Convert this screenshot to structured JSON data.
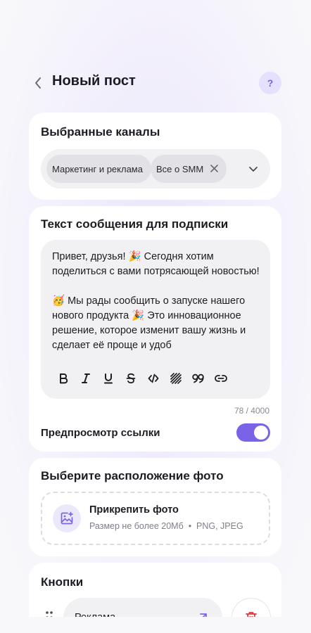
{
  "header": {
    "title": "Новый пост",
    "help_label": "?"
  },
  "channels": {
    "title": "Выбранные каналы",
    "chips": [
      {
        "label": "Маркетинг и реклама"
      },
      {
        "label": "Все о SMM"
      }
    ]
  },
  "message": {
    "title": "Текст сообщения для подписки",
    "text": "Привет, друзья! 🎉 Сегодня хотим поделиться с вами потрясающей новостью!\n\n🥳 Мы рады сообщить о запуске нашего нового продукта 🎉 Это инновационное решение, которое изменит вашу жизнь и сделает её проще и удоб",
    "counter": "78 / 4000",
    "format_tools": [
      "bold-icon",
      "italic-icon",
      "underline-icon",
      "strikethrough-icon",
      "code-icon",
      "spoiler-icon",
      "quote-icon",
      "link-icon"
    ],
    "link_preview_label": "Предпросмотр ссылки",
    "link_preview_enabled": true
  },
  "photo": {
    "title": "Выберите расположение фото",
    "attach_title": "Прикрепить фото",
    "attach_hint": "Размер не более 20Мб  •  PNG, JPEG"
  },
  "buttons": {
    "title": "Кнопки",
    "items": [
      {
        "label": "Реклама"
      }
    ]
  },
  "colors": {
    "accent": "#7b63e8",
    "card": "#ffffff",
    "field": "#f1f1f3"
  }
}
